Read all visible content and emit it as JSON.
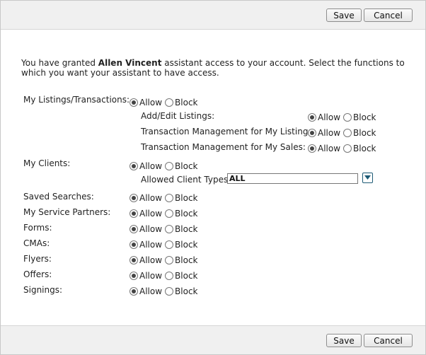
{
  "toolbar": {
    "save_label": "Save",
    "cancel_label": "Cancel"
  },
  "intro": {
    "prefix": "You have granted ",
    "assistant_name": "Allen Vincent",
    "suffix": " assistant access to your account. Select the functions to which you want your assistant to have access."
  },
  "options": {
    "allow": "Allow",
    "block": "Block"
  },
  "permissions": {
    "listings": {
      "label": "My Listings/Transactions:",
      "value": "Allow"
    },
    "add_edit": {
      "label": "Add/Edit Listings:",
      "value": "Allow"
    },
    "tm_listings": {
      "label": "Transaction Management for My Listings:",
      "value": "Allow"
    },
    "tm_sales": {
      "label": "Transaction Management for My Sales:",
      "value": "Allow"
    },
    "clients": {
      "label": "My Clients:",
      "value": "Allow"
    },
    "client_types": {
      "label": "Allowed Client Types:",
      "value": "ALL"
    },
    "saved_searches": {
      "label": "Saved Searches:",
      "value": "Allow"
    },
    "service_partners": {
      "label": "My Service Partners:",
      "value": "Allow"
    },
    "forms": {
      "label": "Forms:",
      "value": "Allow"
    },
    "cmas": {
      "label": "CMAs:",
      "value": "Allow"
    },
    "flyers": {
      "label": "Flyers:",
      "value": "Allow"
    },
    "offers": {
      "label": "Offers:",
      "value": "Allow"
    },
    "signings": {
      "label": "Signings:",
      "value": "Allow"
    }
  },
  "icons": {
    "dropdown": "chevron-down-icon",
    "accent": "#1c5a75"
  }
}
